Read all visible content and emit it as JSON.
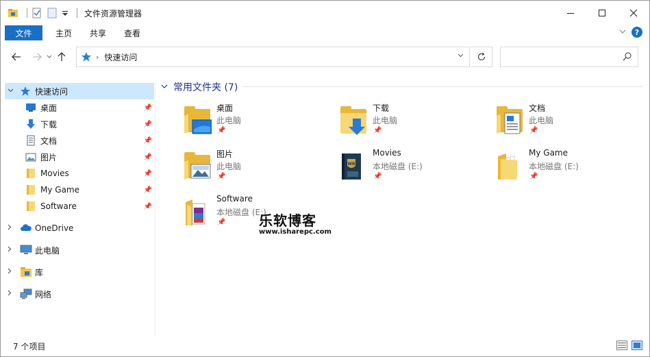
{
  "window": {
    "title": "文件资源管理器",
    "controls": {
      "minimize": "—",
      "maximize": "☐",
      "close": "✕"
    }
  },
  "ribbon": {
    "tabs": [
      "文件",
      "主页",
      "共享",
      "查看"
    ],
    "help": "?",
    "expand": "⌄"
  },
  "address": {
    "crumb": "快速访问",
    "sep": "›",
    "search_placeholder": ""
  },
  "sidebar": {
    "quick_access": "快速访问",
    "pinned": [
      {
        "label": "桌面",
        "icon": "desktop-icon"
      },
      {
        "label": "下载",
        "icon": "download-icon"
      },
      {
        "label": "文档",
        "icon": "document-icon"
      },
      {
        "label": "图片",
        "icon": "picture-icon"
      },
      {
        "label": "Movies",
        "icon": "folder-icon"
      },
      {
        "label": "My Game",
        "icon": "folder-icon"
      },
      {
        "label": "Software",
        "icon": "folder-icon"
      }
    ],
    "groups": [
      {
        "label": "OneDrive",
        "icon": "cloud-icon"
      },
      {
        "label": "此电脑",
        "icon": "computer-icon"
      },
      {
        "label": "库",
        "icon": "library-icon"
      },
      {
        "label": "网络",
        "icon": "network-icon"
      }
    ]
  },
  "content": {
    "group_header": "常用文件夹 (7)",
    "tiles": [
      {
        "name": "桌面",
        "sub": "此电脑",
        "overlay": "desktop"
      },
      {
        "name": "下载",
        "sub": "此电脑",
        "overlay": "download"
      },
      {
        "name": "文档",
        "sub": "此电脑",
        "overlay": "document"
      },
      {
        "name": "图片",
        "sub": "此电脑",
        "overlay": "picture"
      },
      {
        "name": "Movies",
        "sub": "本地磁盘 (E:)",
        "overlay": "movies"
      },
      {
        "name": "My Game",
        "sub": "本地磁盘 (E:)",
        "overlay": "papers"
      },
      {
        "name": "Software",
        "sub": "本地磁盘 (E:)",
        "overlay": "software"
      }
    ]
  },
  "watermark": {
    "big": "乐软博客",
    "small": "www.isharepc.com"
  },
  "status": {
    "count": "7 个项目"
  },
  "colors": {
    "accent": "#1a6fc4",
    "header": "#1e3287",
    "selection": "#cce8ff",
    "folder": "#f8d775"
  }
}
